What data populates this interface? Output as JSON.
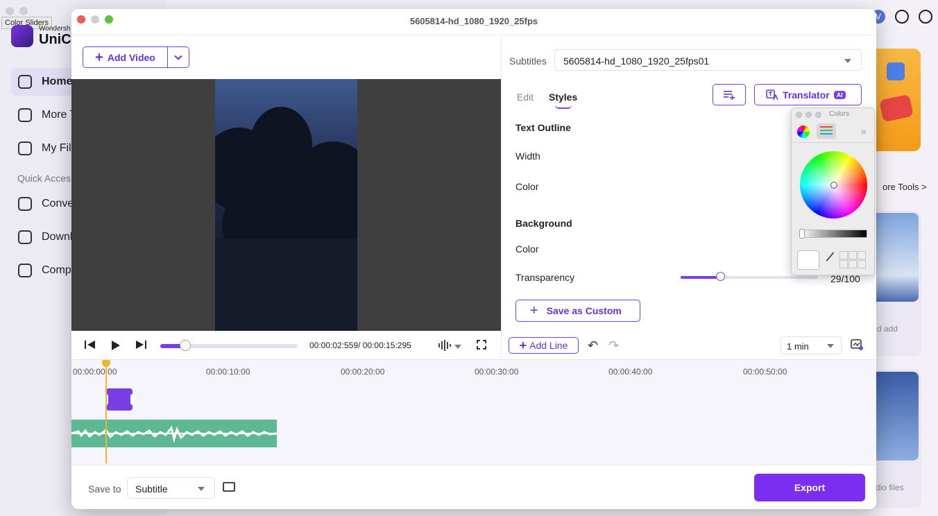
{
  "background_app": {
    "tooltip": "Color Sliders",
    "brand_small": "Wondersh",
    "brand_big": "UniCo",
    "nav": [
      {
        "label": "Home",
        "icon": "home-icon",
        "active": true
      },
      {
        "label": "More T",
        "icon": "toolbox-icon",
        "active": false
      },
      {
        "label": "My Fil",
        "icon": "file-icon",
        "active": false
      }
    ],
    "quick_access_label": "Quick Acces",
    "quick_items": [
      {
        "label": "Conve",
        "icon": "convert-icon"
      },
      {
        "label": "Downl",
        "icon": "download-icon"
      },
      {
        "label": "Comp",
        "icon": "compress-icon"
      }
    ],
    "avatar_letter": "V",
    "more_tools_link": "ore Tools >",
    "card1_text": "d add",
    "card2_text": "dio files"
  },
  "window": {
    "title": "5605814-hd_1080_1920_25fps"
  },
  "left_panel": {
    "add_video_label": "Add Video",
    "timecode": "00:00:02:559/ 00:00:15:295",
    "playback_progress": 0.18
  },
  "right_panel": {
    "subtitles_label": "Subtitles",
    "subtitles_value": "5605814-hd_1080_1920_25fps01",
    "tabs": [
      {
        "label": "Edit",
        "active": false
      },
      {
        "label": "Styles",
        "active": true
      }
    ],
    "translator_label": "Translator",
    "ai_badge": "AI",
    "text_outline_heading": "Text Outline",
    "width_label": "Width",
    "color_label": "Color",
    "background_heading": "Background",
    "bg_color_label": "Color",
    "transparency_label": "Transparency",
    "transparency_value": "29/100",
    "transparency_fraction": 0.29,
    "save_custom_label": "Save as Custom",
    "add_line_label": "Add Line",
    "zoom_value": "1 min"
  },
  "timeline": {
    "ticks": [
      "00:00:00:00",
      "00:00:10:00",
      "00:00:20:00",
      "00:00:30:00",
      "00:00:40:00",
      "00:00:50:00"
    ]
  },
  "footer": {
    "save_to_label": "Save to",
    "save_to_value": "Subtitle",
    "export_label": "Export"
  },
  "colors_panel": {
    "title": "Colors"
  },
  "colors": {
    "accent": "#7a3fe4",
    "audio_track": "#5cb993",
    "playhead": "#f0b62e"
  }
}
